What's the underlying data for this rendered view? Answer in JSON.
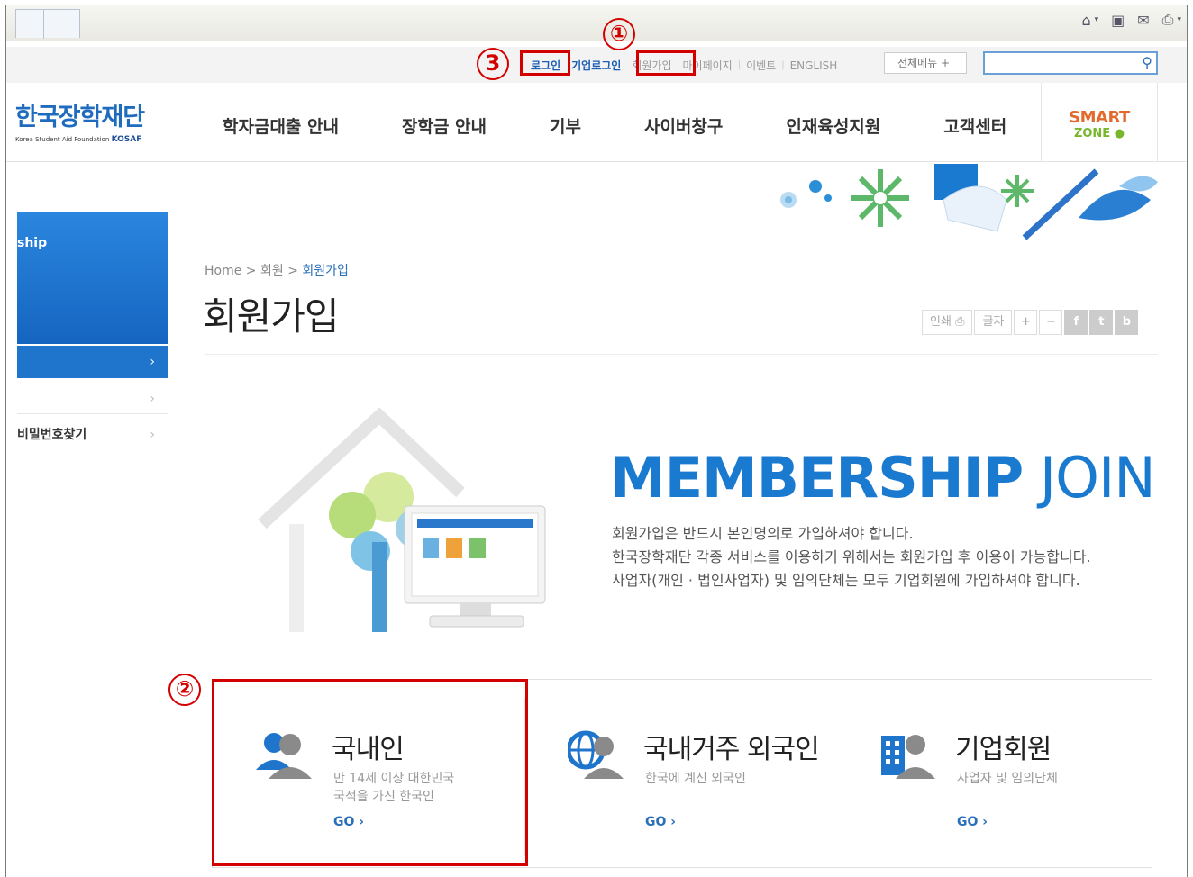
{
  "utility_links": {
    "login": "로그인",
    "corp_login": "기업로그인",
    "join": "회원가입",
    "mypage": "마이페이지",
    "event": "이벤트",
    "english": "ENGLISH",
    "all_menu": "전체메뉴 +",
    "search_placeholder": ""
  },
  "header": {
    "logo_main": "한국장학재단",
    "logo_sub": "Korea Student Aid Foundation",
    "logo_abbr": "KOSAF",
    "nav": [
      "학자금대출 안내",
      "장학금 안내",
      "기부",
      "사이버창구",
      "인재육성지원",
      "고객센터"
    ],
    "smart_line1": "SMART",
    "smart_line2": "ZONE"
  },
  "side_nav": {
    "panel_label": "ship",
    "item_active": "",
    "item_two": "",
    "item_three": "비밀번호찾기",
    "chevron": "›"
  },
  "breadcrumb": {
    "home": "Home",
    "level1": "회원",
    "current": "회원가입",
    "sep": ">"
  },
  "page_title": "회원가입",
  "tools": {
    "print": "인쇄",
    "font": "글자",
    "plus": "+",
    "minus": "−",
    "facebook": "f",
    "twitter": "t",
    "blog": "b"
  },
  "hero": {
    "title_bold": "MEMBERSHIP",
    "title_light": "JOIN",
    "lines": [
      "회원가입은 반드시 본인명의로 가입하셔야 합니다.",
      "한국장학재단 각종 서비스를 이용하기 위해서는 회원가입 후 이용이 가능합니다.",
      "사업자(개인 · 법인사업자) 및 임의단체는 모두 기업회원에 가입하셔야 합니다."
    ]
  },
  "member_types": [
    {
      "title": "국내인",
      "desc1": "만 14세 이상 대한민국",
      "desc2": "국적을 가진 한국인",
      "go": "GO ›"
    },
    {
      "title": "국내거주 외국인",
      "desc1": "한국에 계신 외국인",
      "desc2": "",
      "go": "GO ›"
    },
    {
      "title": "기업회원",
      "desc1": "사업자 및 임의단체",
      "desc2": "",
      "go": "GO ›"
    }
  ],
  "annotations": {
    "one": "①",
    "two": "②",
    "three": "3"
  },
  "colors": {
    "brand_blue": "#1f6cbf",
    "annotation_red": "#d40000",
    "smart_orange": "#e26a2c",
    "smart_green": "#78b62c"
  }
}
